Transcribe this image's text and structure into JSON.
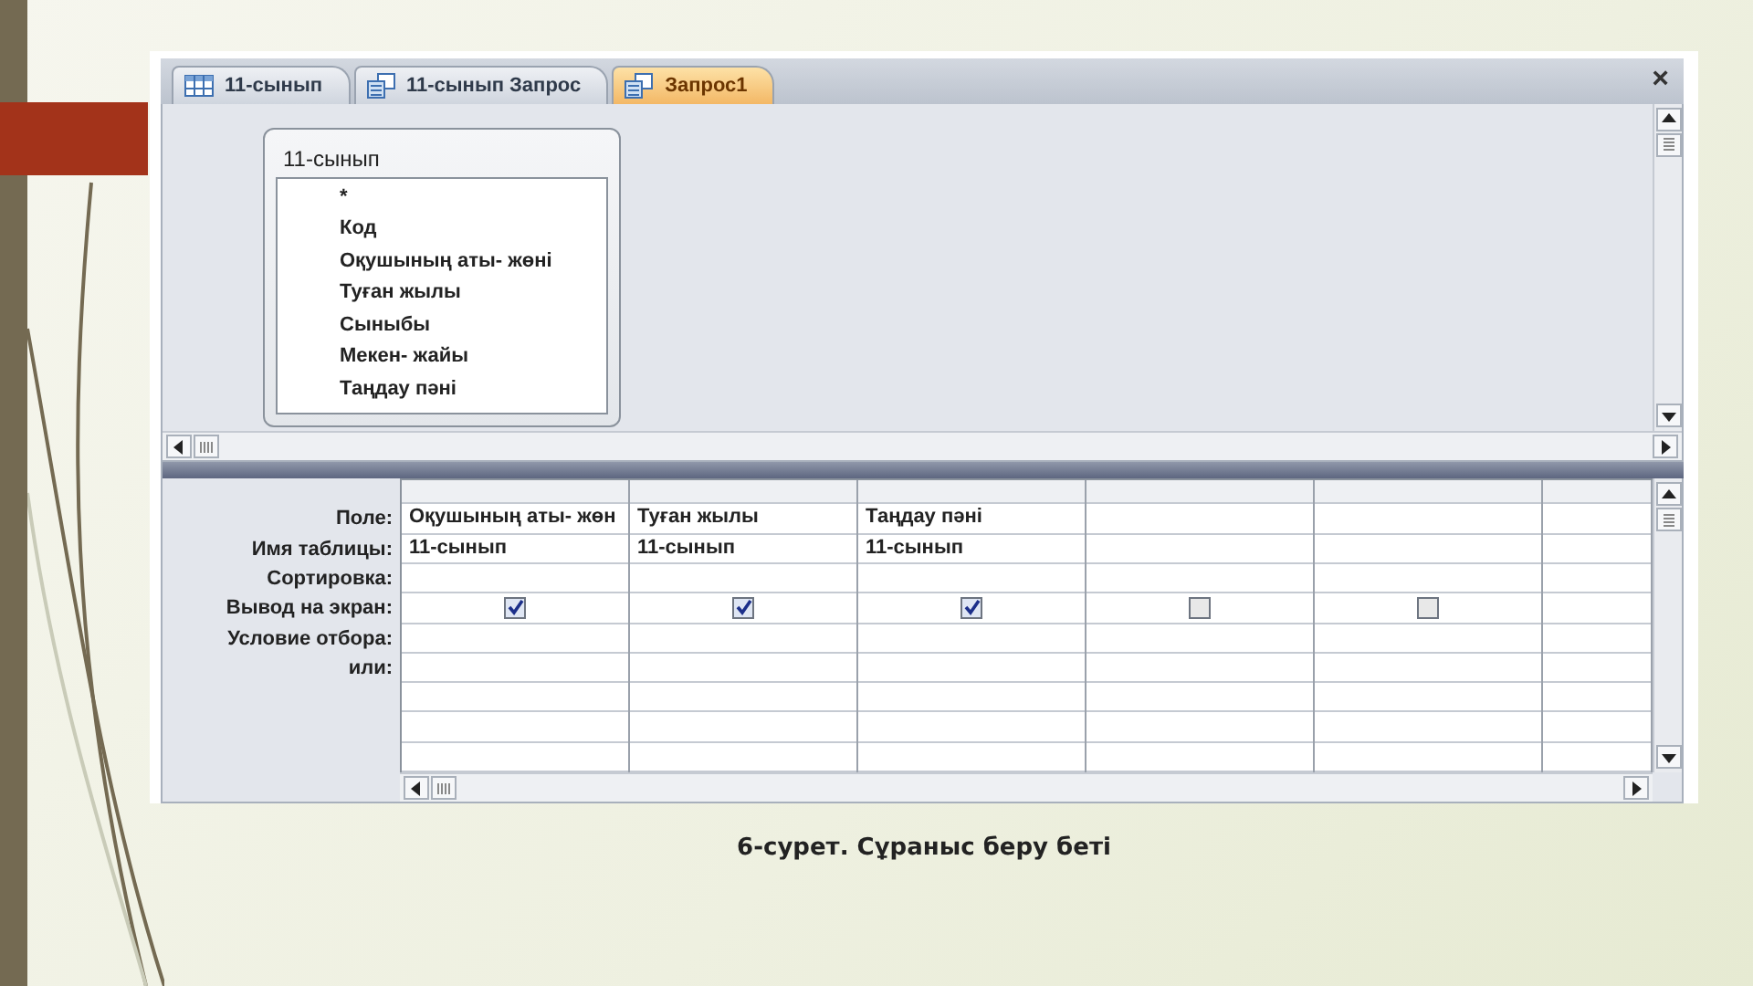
{
  "tabs": [
    {
      "label": "11-сынып",
      "kind": "table",
      "selected": false
    },
    {
      "label": "11-сынып Запрос",
      "kind": "query",
      "selected": false
    },
    {
      "label": "Запрос1",
      "kind": "query",
      "selected": true
    }
  ],
  "close": "×",
  "field_list": {
    "title": "11-сынып",
    "fields": [
      "*",
      "Код",
      "Оқушының аты- жөні",
      "Туған жылы",
      "Сыныбы",
      "Мекен- жайы",
      "Таңдау  пәні"
    ]
  },
  "design_grid": {
    "row_labels": [
      "Поле:",
      "Имя таблицы:",
      "Сортировка:",
      "Вывод на экран:",
      "Условие отбора:",
      "или:"
    ],
    "columns": [
      {
        "field": "Оқушының аты- жөн",
        "table": "11-сынып",
        "show": true
      },
      {
        "field": "Туған жылы",
        "table": "11-сынып",
        "show": true
      },
      {
        "field": "Таңдау  пәні",
        "table": "11-сынып",
        "show": true
      },
      {
        "show": false
      },
      {
        "show": false
      }
    ]
  },
  "caption": "6-сурет. Сұраныс беру беті"
}
